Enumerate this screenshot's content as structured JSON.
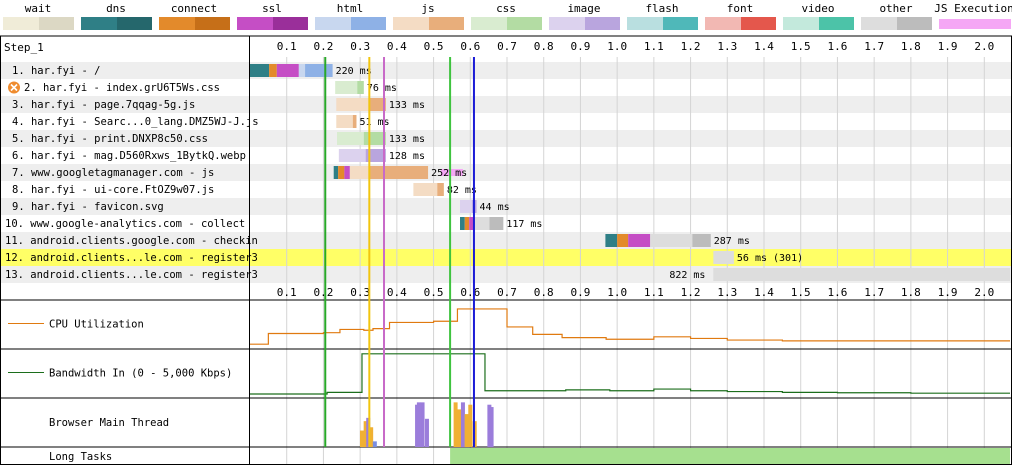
{
  "legend": [
    {
      "label": "wait",
      "colors": [
        "#f0ecd8",
        "#dcd8c4"
      ]
    },
    {
      "label": "dns",
      "colors": [
        "#2f7f86",
        "#25676c"
      ]
    },
    {
      "label": "connect",
      "colors": [
        "#e38a2b",
        "#c66f18"
      ]
    },
    {
      "label": "ssl",
      "colors": [
        "#c54ec5",
        "#9a2f9a"
      ]
    },
    {
      "label": "html",
      "colors": [
        "#c8d7ef",
        "#8eb1e6"
      ]
    },
    {
      "label": "js",
      "colors": [
        "#f4dcc4",
        "#e8ae7b"
      ]
    },
    {
      "label": "css",
      "colors": [
        "#d9ecd0",
        "#b3dca3"
      ]
    },
    {
      "label": "image",
      "colors": [
        "#dcd2ee",
        "#b9a5de"
      ]
    },
    {
      "label": "flash",
      "colors": [
        "#b9dfe0",
        "#4fb8b9"
      ]
    },
    {
      "label": "font",
      "colors": [
        "#f2b8b3",
        "#e4574c"
      ]
    },
    {
      "label": "video",
      "colors": [
        "#c3e9dc",
        "#4cc3a8"
      ]
    },
    {
      "label": "other",
      "colors": [
        "#dddddd",
        "#bcbcbc"
      ]
    },
    {
      "label": "JS Execution",
      "colors": [
        "#f5a7f5",
        "#f5a7f5"
      ]
    }
  ],
  "step_label": "Step_1",
  "chart_data": {
    "type": "waterfall",
    "x_ticks": [
      "0.1",
      "0.2",
      "0.3",
      "0.4",
      "0.5",
      "0.6",
      "0.7",
      "0.8",
      "0.9",
      "1.0",
      "1.1",
      "1.2",
      "1.3",
      "1.4",
      "1.5",
      "1.6",
      "1.7",
      "1.8",
      "1.9",
      "2.0"
    ],
    "x_range": [
      0,
      2.07
    ],
    "markers": [
      {
        "t": 0.205,
        "color": "#28a828"
      },
      {
        "t": 0.325,
        "color": "#f2c50e"
      },
      {
        "t": 0.365,
        "color": "#c86ac8"
      },
      {
        "t": 0.545,
        "color": "#3fc33f"
      },
      {
        "t": 0.61,
        "color": "#1c1cd6"
      }
    ],
    "requests": [
      {
        "label": "1. har.fyi - /",
        "timing": "220 ms",
        "type": "html",
        "error": false,
        "highlight": false,
        "wait": [
          0,
          0
        ],
        "dns": [
          0,
          0.052
        ],
        "connect": [
          0.052,
          0.073
        ],
        "ssl": [
          0.073,
          0.133
        ],
        "ttfb": [
          0.133,
          0.15
        ],
        "download": [
          0.15,
          0.225
        ],
        "js": []
      },
      {
        "label": "2. har.fyi - index.grU6T5Ws.css",
        "timing": "76 ms",
        "type": "css",
        "error": true,
        "highlight": false,
        "wait": [
          0,
          0
        ],
        "dns": [
          0,
          0
        ],
        "connect": [
          0,
          0
        ],
        "ssl": [
          0,
          0
        ],
        "ttfb": [
          0.232,
          0.292
        ],
        "download": [
          0.292,
          0.31
        ],
        "js": []
      },
      {
        "label": "3. har.fyi - page.7qqag-5g.js",
        "timing": "133 ms",
        "type": "js",
        "error": false,
        "highlight": false,
        "wait": [
          0,
          0
        ],
        "dns": [
          0,
          0
        ],
        "connect": [
          0,
          0
        ],
        "ssl": [
          0,
          0
        ],
        "ttfb": [
          0.235,
          0.325
        ],
        "download": [
          0.325,
          0.37
        ],
        "js": []
      },
      {
        "label": "4. har.fyi - Searc...0_lang.DMZ5WJ-J.js",
        "timing": "51 ms",
        "type": "js",
        "error": false,
        "highlight": false,
        "wait": [
          0,
          0
        ],
        "dns": [
          0,
          0
        ],
        "connect": [
          0,
          0
        ],
        "ssl": [
          0,
          0
        ],
        "ttfb": [
          0.235,
          0.28
        ],
        "download": [
          0.28,
          0.29
        ],
        "js": []
      },
      {
        "label": "5. har.fyi - print.DNXP8c50.css",
        "timing": "133 ms",
        "type": "css",
        "error": false,
        "highlight": false,
        "wait": [
          0,
          0
        ],
        "dns": [
          0,
          0
        ],
        "connect": [
          0,
          0
        ],
        "ssl": [
          0,
          0
        ],
        "ttfb": [
          0.237,
          0.31
        ],
        "download": [
          0.31,
          0.37
        ],
        "js": []
      },
      {
        "label": "6. har.fyi - mag.D560Rxws_1BytkQ.webp",
        "timing": "128 ms",
        "type": "image",
        "error": false,
        "highlight": false,
        "wait": [
          0,
          0
        ],
        "dns": [
          0,
          0
        ],
        "connect": [
          0,
          0
        ],
        "ssl": [
          0,
          0
        ],
        "ttfb": [
          0.242,
          0.315
        ],
        "download": [
          0.315,
          0.37
        ],
        "js": []
      },
      {
        "label": "7. www.googletagmanager.com - js",
        "timing": "252 ms",
        "type": "js",
        "error": false,
        "highlight": false,
        "wait": [
          0,
          0
        ],
        "dns": [
          0.228,
          0.24
        ],
        "connect": [
          0.24,
          0.257
        ],
        "ssl": [
          0.257,
          0.272
        ],
        "ttfb": [
          0.272,
          0.323
        ],
        "download": [
          0.323,
          0.485
        ],
        "js": [
          [
            0.52,
            0.58
          ]
        ]
      },
      {
        "label": "8. har.fyi - ui-core.FtOZ9w07.js",
        "timing": "82 ms",
        "type": "js",
        "error": false,
        "highlight": false,
        "wait": [
          0,
          0
        ],
        "dns": [
          0,
          0
        ],
        "connect": [
          0,
          0
        ],
        "ssl": [
          0,
          0
        ],
        "ttfb": [
          0.445,
          0.51
        ],
        "download": [
          0.51,
          0.528
        ],
        "js": []
      },
      {
        "label": "9. har.fyi - favicon.svg",
        "timing": "44 ms",
        "type": "image",
        "error": false,
        "highlight": false,
        "wait": [
          0,
          0
        ],
        "dns": [
          0,
          0
        ],
        "connect": [
          0,
          0
        ],
        "ssl": [
          0,
          0
        ],
        "ttfb": [
          0.572,
          0.605
        ],
        "download": [
          0.605,
          0.617
        ],
        "js": []
      },
      {
        "label": "10. www.google-analytics.com - collect",
        "timing": "117 ms",
        "type": "other",
        "error": false,
        "highlight": false,
        "wait": [
          0,
          0
        ],
        "dns": [
          0.572,
          0.585
        ],
        "connect": [
          0.585,
          0.597
        ],
        "ssl": [
          0.597,
          0.61
        ],
        "ttfb": [
          0.61,
          0.652
        ],
        "download": [
          0.652,
          0.69
        ],
        "js": []
      },
      {
        "label": "11. android.clients.google.com - checkin",
        "timing": "287 ms",
        "type": "other",
        "error": false,
        "highlight": false,
        "wait": [
          0,
          0
        ],
        "dns": [
          0.968,
          1.0
        ],
        "connect": [
          1.0,
          1.03
        ],
        "ssl": [
          1.03,
          1.09
        ],
        "ttfb": [
          1.09,
          1.205
        ],
        "download": [
          1.205,
          1.255
        ],
        "js": []
      },
      {
        "label": "12. android.clients...le.com - register3",
        "timing": "56 ms (301)",
        "type": "other",
        "error": false,
        "highlight": true,
        "wait": [
          0,
          0
        ],
        "dns": [
          0,
          0
        ],
        "connect": [
          0,
          0
        ],
        "ssl": [
          0,
          0
        ],
        "ttfb": [
          1.262,
          1.318
        ],
        "download": [
          0,
          0
        ],
        "js": []
      },
      {
        "label": "13. android.clients...le.com - register3",
        "timing": "822 ms",
        "type": "other",
        "error": false,
        "highlight": false,
        "wait": [
          0,
          0
        ],
        "dns": [
          0,
          0
        ],
        "connect": [
          0,
          0
        ],
        "ssl": [
          0,
          0
        ],
        "ttfb": [
          1.262,
          2.07
        ],
        "download": [
          0,
          0
        ],
        "js": []
      }
    ],
    "cpu": {
      "label": "CPU Utilization",
      "color": "#e07a10",
      "points": [
        [
          0,
          0.02
        ],
        [
          0.05,
          0.28
        ],
        [
          0.1,
          0.28
        ],
        [
          0.2,
          0.3
        ],
        [
          0.245,
          0.38
        ],
        [
          0.31,
          0.36
        ],
        [
          0.335,
          0.4
        ],
        [
          0.38,
          0.55
        ],
        [
          0.455,
          0.55
        ],
        [
          0.5,
          0.58
        ],
        [
          0.565,
          0.88
        ],
        [
          0.605,
          0.88
        ],
        [
          0.7,
          0.44
        ],
        [
          0.77,
          0.26
        ],
        [
          0.85,
          0.18
        ],
        [
          0.97,
          0.14
        ],
        [
          1.1,
          0.2
        ],
        [
          1.2,
          0.16
        ],
        [
          1.3,
          0.12
        ],
        [
          1.45,
          0.1
        ],
        [
          1.6,
          0.1
        ],
        [
          1.8,
          0.1
        ],
        [
          2.07,
          0.1
        ]
      ]
    },
    "bandwidth": {
      "label": "Bandwidth In (0 - 5,000 Kbps)",
      "color": "#1c6e1c",
      "points": [
        [
          0,
          0.0
        ],
        [
          0.15,
          0.0
        ],
        [
          0.21,
          0.04
        ],
        [
          0.245,
          0.04
        ],
        [
          0.305,
          0.98
        ],
        [
          0.61,
          0.98
        ],
        [
          0.64,
          0.08
        ],
        [
          0.75,
          0.08
        ],
        [
          0.86,
          0.1
        ],
        [
          0.98,
          0.08
        ],
        [
          1.1,
          0.12
        ],
        [
          1.2,
          0.08
        ],
        [
          1.3,
          0.06
        ],
        [
          1.45,
          0.04
        ],
        [
          1.6,
          0.03
        ],
        [
          1.8,
          0.02
        ],
        [
          2.07,
          0.02
        ]
      ]
    },
    "main_thread": {
      "label": "Browser Main Thread",
      "bars": [
        {
          "t": 0.305,
          "h": 0.35,
          "color": "#f0b034"
        },
        {
          "t": 0.315,
          "h": 0.55,
          "color": "#f0b034"
        },
        {
          "t": 0.322,
          "h": 0.62,
          "color": "#9b7ddb"
        },
        {
          "t": 0.33,
          "h": 0.42,
          "color": "#f0b034"
        },
        {
          "t": 0.34,
          "h": 0.12,
          "color": "#7a8ee0"
        },
        {
          "t": 0.455,
          "h": 0.9,
          "color": "#9b7ddb"
        },
        {
          "t": 0.46,
          "h": 0.95,
          "color": "#9b7ddb"
        },
        {
          "t": 0.47,
          "h": 0.95,
          "color": "#9b7ddb"
        },
        {
          "t": 0.482,
          "h": 0.6,
          "color": "#9b7ddb"
        },
        {
          "t": 0.56,
          "h": 0.95,
          "color": "#f0b034"
        },
        {
          "t": 0.57,
          "h": 0.8,
          "color": "#f0b034"
        },
        {
          "t": 0.58,
          "h": 0.95,
          "color": "#9b7ddb"
        },
        {
          "t": 0.59,
          "h": 0.7,
          "color": "#f0b034"
        },
        {
          "t": 0.6,
          "h": 0.9,
          "color": "#f0b034"
        },
        {
          "t": 0.612,
          "h": 0.55,
          "color": "#f0b034"
        },
        {
          "t": 0.652,
          "h": 0.9,
          "color": "#9b7ddb"
        },
        {
          "t": 0.658,
          "h": 0.85,
          "color": "#9b7ddb"
        }
      ]
    },
    "long_tasks": {
      "label": "Long Tasks",
      "color": "#a6e08f",
      "start": 0.545,
      "end": 2.07
    }
  }
}
